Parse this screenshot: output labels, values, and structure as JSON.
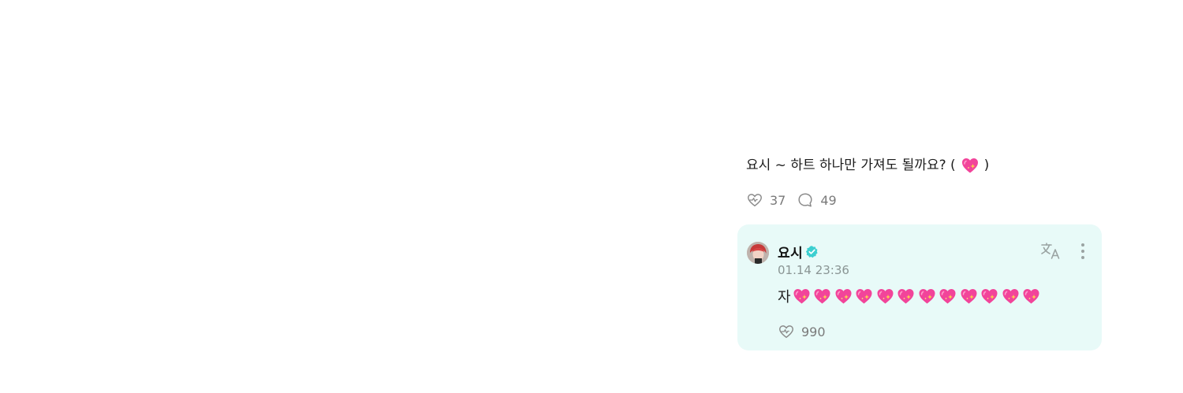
{
  "post": {
    "text_before": "요시 ~ 하트 하나만 가져도 될까요? (",
    "text_emoji": "sparkling-heart",
    "text_after": ")",
    "like_count": "37",
    "comment_count": "49"
  },
  "comment": {
    "author": "요시",
    "verified": true,
    "timestamp": "01.14 23:36",
    "text_prefix": "자",
    "heart_emoji": "sparkling-heart",
    "heart_count": 12,
    "like_count": "990"
  },
  "colors": {
    "card_background": "#e8faf8",
    "verified_badge": "#3ccfd0",
    "heart_pink": "#f2449a",
    "muted_text": "#7a7a7a"
  },
  "icons": {
    "like": "heart-like-icon",
    "comment": "speech-bubble-icon",
    "translate": "translate-icon",
    "more": "more-vertical-icon",
    "verified": "verified-badge-icon"
  }
}
